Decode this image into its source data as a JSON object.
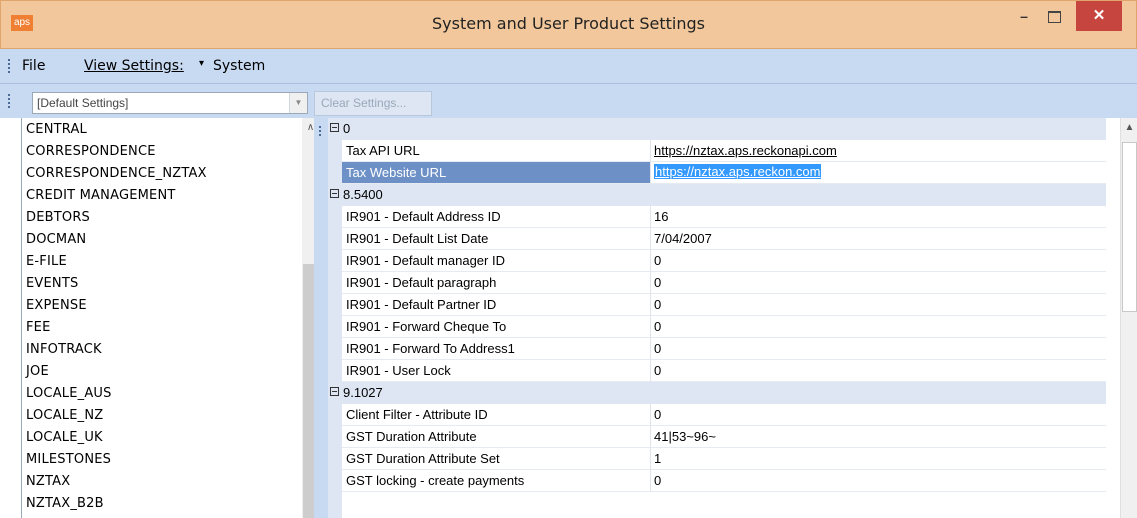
{
  "window": {
    "app_icon_text": "aps",
    "title": "System and User Product Settings",
    "minimize_glyph": "–",
    "close_glyph": "✕"
  },
  "menu": {
    "file": "File",
    "view_settings": "View Settings:",
    "dropdown_arrow": "▾",
    "system": "System"
  },
  "toolbar": {
    "settings_combo_value": "[Default Settings]",
    "clear_button": "Clear Settings..."
  },
  "left_list": {
    "items": [
      "CENTRAL",
      "CORRESPONDENCE",
      "CORRESPONDENCE_NZTAX",
      "CREDIT MANAGEMENT",
      "DEBTORS",
      "DOCMAN",
      "E-FILE",
      "EVENTS",
      "EXPENSE",
      "FEE",
      "INFOTRACK",
      "JOE",
      "LOCALE_AUS",
      "LOCALE_NZ",
      "LOCALE_UK",
      "MILESTONES",
      "NZTAX",
      "NZTAX_B2B"
    ],
    "scroll_up_glyph": "∧"
  },
  "grid": {
    "scroll_up_glyph": "▲",
    "rows": [
      {
        "type": "category",
        "label": "0"
      },
      {
        "type": "prop",
        "name": "Tax API URL",
        "value": "https://nztax.aps.reckonapi.com"
      },
      {
        "type": "prop",
        "name": "Tax Website URL",
        "value": "https://nztax.aps.reckon.com"
      },
      {
        "type": "category",
        "label": "8.5400"
      },
      {
        "type": "prop",
        "name": "IR901 - Default Address ID",
        "value": "16"
      },
      {
        "type": "prop",
        "name": "IR901 - Default List Date",
        "value": "7/04/2007"
      },
      {
        "type": "prop",
        "name": "IR901 - Default manager ID",
        "value": "0"
      },
      {
        "type": "prop",
        "name": "IR901 - Default paragraph",
        "value": "0"
      },
      {
        "type": "prop",
        "name": "IR901 - Default Partner ID",
        "value": "0"
      },
      {
        "type": "prop",
        "name": "IR901 - Forward Cheque To",
        "value": "0"
      },
      {
        "type": "prop",
        "name": "IR901 - Forward To Address1",
        "value": "0"
      },
      {
        "type": "prop",
        "name": "IR901 - User Lock",
        "value": "0"
      },
      {
        "type": "category",
        "label": "9.1027"
      },
      {
        "type": "prop",
        "name": "Client Filter - Attribute ID",
        "value": "0"
      },
      {
        "type": "prop",
        "name": "GST Duration Attribute",
        "value": "41|53~96~"
      },
      {
        "type": "prop",
        "name": "GST Duration Attribute Set",
        "value": "1"
      },
      {
        "type": "prop",
        "name": "GST locking - create payments",
        "value": "0"
      }
    ]
  }
}
